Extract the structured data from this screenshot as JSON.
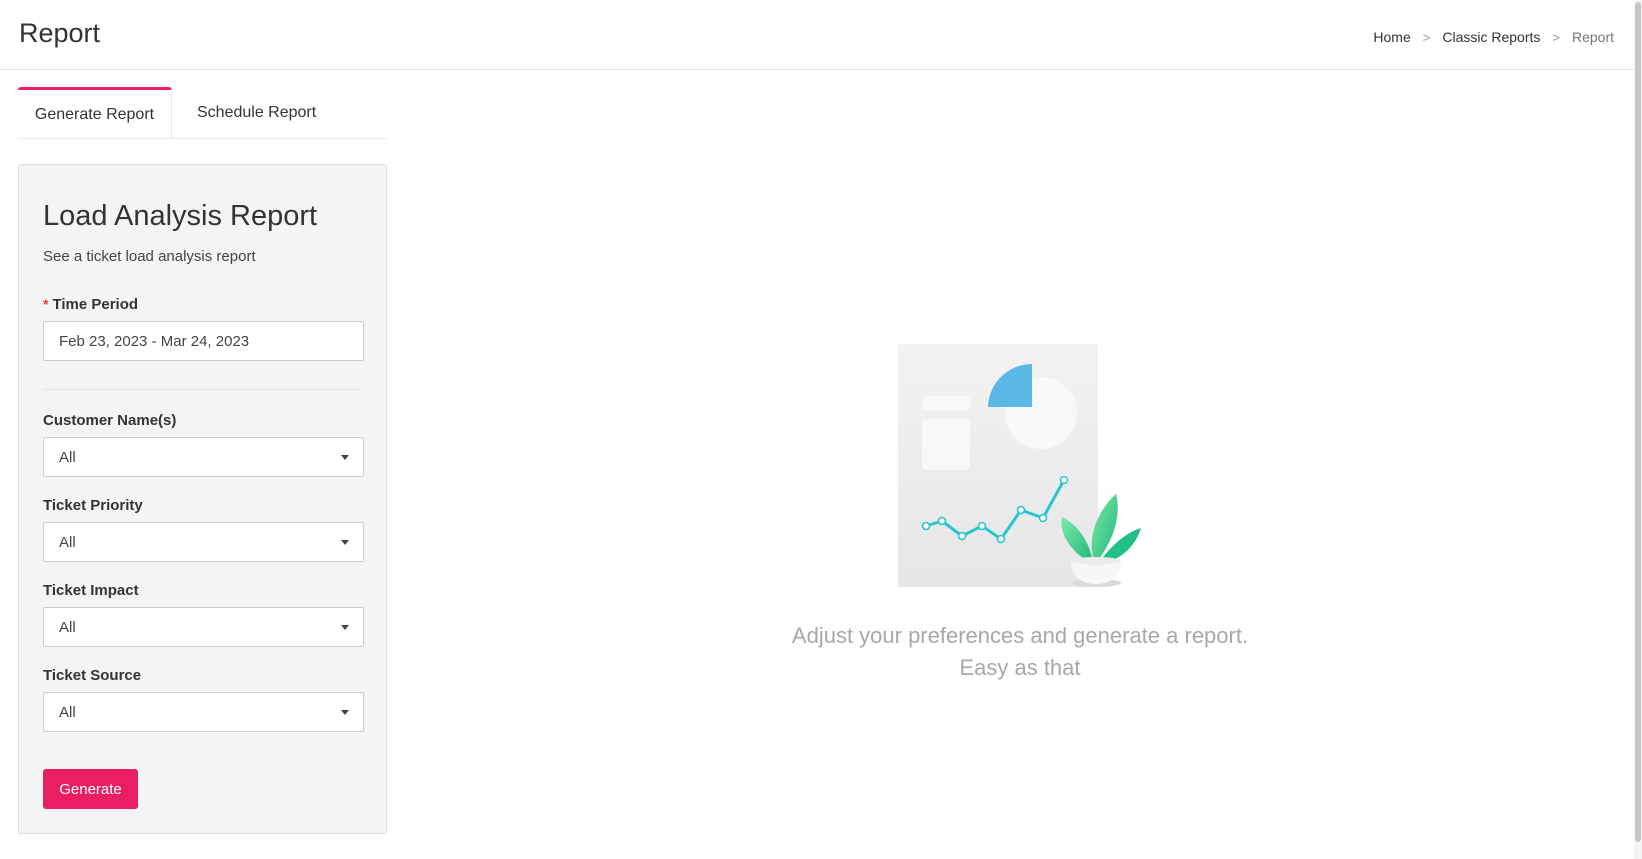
{
  "header": {
    "title": "Report",
    "breadcrumb": [
      {
        "label": "Home"
      },
      {
        "label": "Classic Reports"
      },
      {
        "label": "Report"
      }
    ],
    "separator": ">"
  },
  "tabs": [
    {
      "label": "Generate Report",
      "active": true
    },
    {
      "label": "Schedule Report",
      "active": false
    }
  ],
  "form": {
    "title": "Load Analysis Report",
    "subtitle": "See a ticket load analysis report",
    "time_period": {
      "label": "Time Period",
      "required_mark": "*",
      "value": "Feb 23, 2023 - Mar 24, 2023"
    },
    "fields": [
      {
        "label": "Customer Name(s)",
        "value": "All"
      },
      {
        "label": "Ticket Priority",
        "value": "All"
      },
      {
        "label": "Ticket Impact",
        "value": "All"
      },
      {
        "label": "Ticket Source",
        "value": "All"
      }
    ],
    "generate_label": "Generate"
  },
  "empty_state": {
    "line1": "Adjust your preferences and generate a report.",
    "line2": "Easy as that"
  },
  "colors": {
    "accent": "#e91e63",
    "required": "#e53935",
    "chart_line": "#26c6d0",
    "pie_blue": "#5ab8e6",
    "leaf_green": "#2ecc71"
  }
}
